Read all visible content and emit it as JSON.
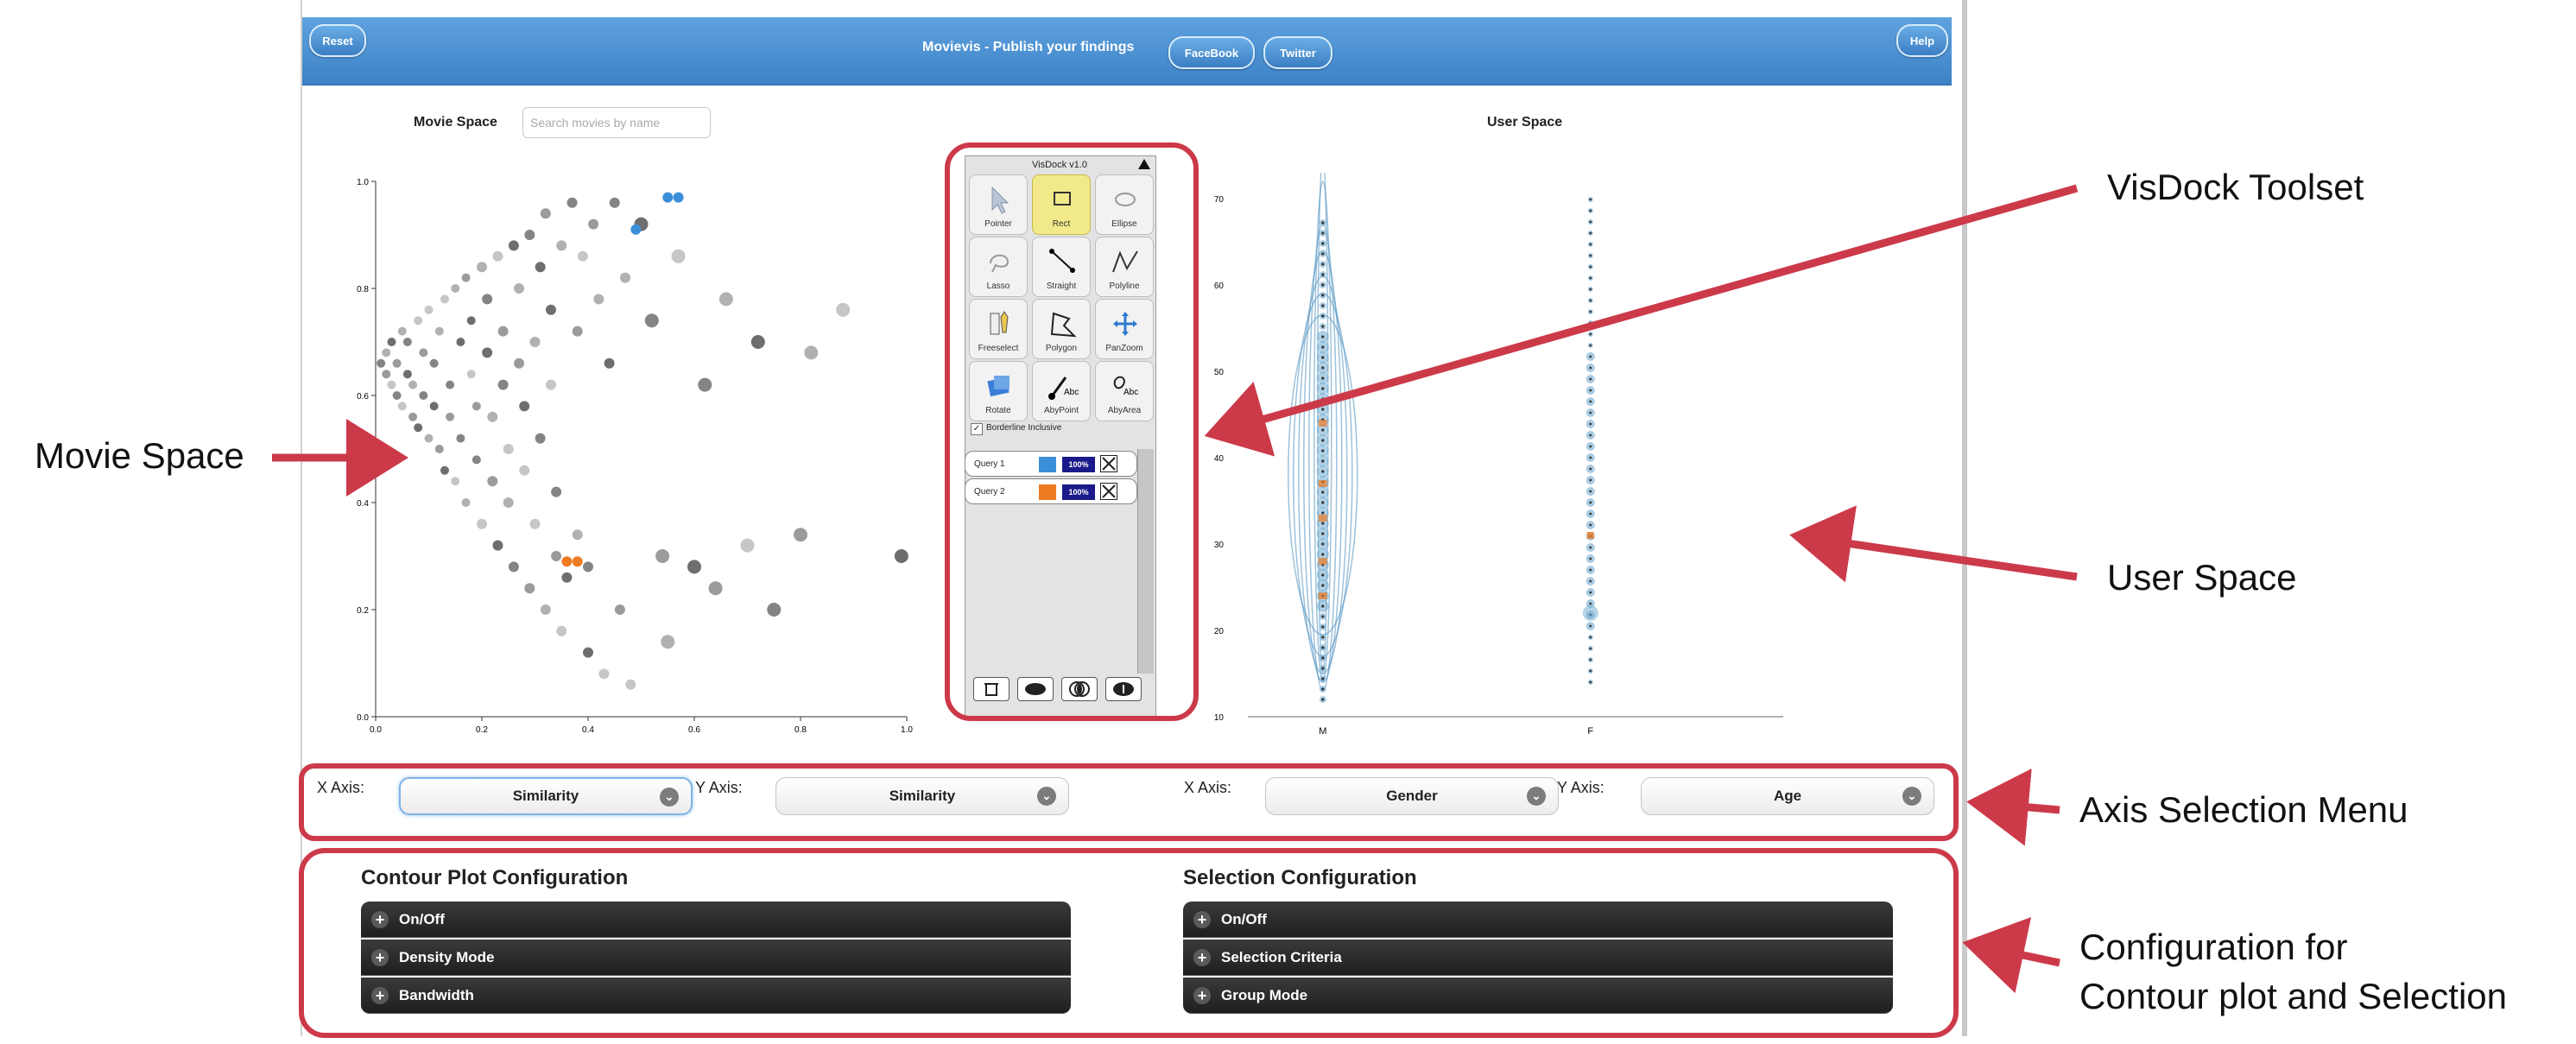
{
  "topbar": {
    "title": "Movievis - Publish your findings",
    "reset": "Reset",
    "facebook": "FaceBook",
    "twitter": "Twitter",
    "help": "Help"
  },
  "movie_space": {
    "label": "Movie Space",
    "search_placeholder": "Search movies by name",
    "chart_data": {
      "type": "scatter",
      "xlim": [
        0.0,
        1.0
      ],
      "ylim": [
        0.0,
        1.0
      ],
      "x_ticks": [
        "0.0",
        "0.2",
        "0.4",
        "0.6",
        "0.8",
        "1.0"
      ],
      "y_ticks": [
        "0.0",
        "0.2",
        "0.4",
        "0.6",
        "0.8",
        "1.0"
      ],
      "points": [
        [
          0.01,
          0.66
        ],
        [
          0.02,
          0.64
        ],
        [
          0.02,
          0.68
        ],
        [
          0.03,
          0.62
        ],
        [
          0.03,
          0.7
        ],
        [
          0.04,
          0.6
        ],
        [
          0.04,
          0.66
        ],
        [
          0.05,
          0.72
        ],
        [
          0.05,
          0.58
        ],
        [
          0.06,
          0.64
        ],
        [
          0.06,
          0.7
        ],
        [
          0.07,
          0.56
        ],
        [
          0.07,
          0.62
        ],
        [
          0.08,
          0.74
        ],
        [
          0.08,
          0.54
        ],
        [
          0.09,
          0.6
        ],
        [
          0.09,
          0.68
        ],
        [
          0.1,
          0.52
        ],
        [
          0.1,
          0.76
        ],
        [
          0.11,
          0.58
        ],
        [
          0.11,
          0.66
        ],
        [
          0.12,
          0.5
        ],
        [
          0.12,
          0.72
        ],
        [
          0.13,
          0.78
        ],
        [
          0.13,
          0.46
        ],
        [
          0.14,
          0.62
        ],
        [
          0.14,
          0.56
        ],
        [
          0.15,
          0.8
        ],
        [
          0.15,
          0.44
        ],
        [
          0.16,
          0.7
        ],
        [
          0.16,
          0.52
        ],
        [
          0.17,
          0.82
        ],
        [
          0.17,
          0.4
        ],
        [
          0.18,
          0.64
        ],
        [
          0.18,
          0.74
        ],
        [
          0.19,
          0.48
        ],
        [
          0.19,
          0.58
        ],
        [
          0.2,
          0.84
        ],
        [
          0.2,
          0.36
        ],
        [
          0.21,
          0.68
        ],
        [
          0.21,
          0.78
        ],
        [
          0.22,
          0.44
        ],
        [
          0.22,
          0.56
        ],
        [
          0.23,
          0.86
        ],
        [
          0.23,
          0.32
        ],
        [
          0.24,
          0.62
        ],
        [
          0.24,
          0.72
        ],
        [
          0.25,
          0.4
        ],
        [
          0.25,
          0.5
        ],
        [
          0.26,
          0.88
        ],
        [
          0.26,
          0.28
        ],
        [
          0.27,
          0.66
        ],
        [
          0.27,
          0.8
        ],
        [
          0.28,
          0.46
        ],
        [
          0.28,
          0.58
        ],
        [
          0.29,
          0.9
        ],
        [
          0.29,
          0.24
        ],
        [
          0.3,
          0.7
        ],
        [
          0.3,
          0.36
        ],
        [
          0.31,
          0.84
        ],
        [
          0.31,
          0.52
        ],
        [
          0.32,
          0.94
        ],
        [
          0.32,
          0.2
        ],
        [
          0.33,
          0.62
        ],
        [
          0.33,
          0.76
        ],
        [
          0.34,
          0.42
        ],
        [
          0.34,
          0.3
        ],
        [
          0.35,
          0.88
        ],
        [
          0.35,
          0.16
        ],
        [
          0.36,
          0.26
        ],
        [
          0.37,
          0.96
        ],
        [
          0.38,
          0.72
        ],
        [
          0.38,
          0.34
        ],
        [
          0.39,
          0.86
        ],
        [
          0.4,
          0.12
        ],
        [
          0.4,
          0.28
        ],
        [
          0.41,
          0.92
        ],
        [
          0.42,
          0.78
        ],
        [
          0.43,
          0.08
        ],
        [
          0.44,
          0.66
        ],
        [
          0.45,
          0.96
        ],
        [
          0.46,
          0.2
        ],
        [
          0.47,
          0.82
        ],
        [
          0.48,
          0.06
        ],
        [
          0.5,
          0.92
        ],
        [
          0.52,
          0.74
        ],
        [
          0.54,
          0.3
        ],
        [
          0.55,
          0.14
        ],
        [
          0.57,
          0.86
        ],
        [
          0.6,
          0.28
        ],
        [
          0.62,
          0.62
        ],
        [
          0.64,
          0.24
        ],
        [
          0.66,
          0.78
        ],
        [
          0.7,
          0.32
        ],
        [
          0.72,
          0.7
        ],
        [
          0.75,
          0.2
        ],
        [
          0.8,
          0.34
        ],
        [
          0.82,
          0.68
        ],
        [
          0.88,
          0.76
        ],
        [
          0.99,
          0.3
        ]
      ],
      "highlighted": {
        "query_1": [
          [
            0.55,
            0.97
          ],
          [
            0.57,
            0.97
          ],
          [
            0.49,
            0.91
          ]
        ],
        "query_2": [
          [
            0.36,
            0.29
          ],
          [
            0.38,
            0.29
          ]
        ]
      }
    }
  },
  "user_space": {
    "label": "User Space",
    "chart_data": {
      "type": "scatter",
      "categories": [
        "M",
        "F"
      ],
      "ylim": [
        10,
        72
      ],
      "y_ticks": [
        "10",
        "20",
        "30",
        "40",
        "50",
        "60",
        "70"
      ],
      "contour": true
    }
  },
  "visdock": {
    "title": "VisDock v1.0",
    "tools": [
      {
        "label": "Pointer",
        "icon": "pointer-icon"
      },
      {
        "label": "Rect",
        "icon": "rect-icon"
      },
      {
        "label": "Ellipse",
        "icon": "ellipse-icon"
      },
      {
        "label": "Lasso",
        "icon": "lasso-icon"
      },
      {
        "label": "Straight",
        "icon": "straight-icon"
      },
      {
        "label": "Polyline",
        "icon": "polyline-icon"
      },
      {
        "label": "Freeselect",
        "icon": "freeselect-icon"
      },
      {
        "label": "Polygon",
        "icon": "polygon-icon"
      },
      {
        "label": "PanZoom",
        "icon": "panzoom-icon"
      },
      {
        "label": "Rotate",
        "icon": "rotate-icon"
      },
      {
        "label": "AbyPoint",
        "icon": "annotate-point-icon"
      },
      {
        "label": "AbyArea",
        "icon": "annotate-area-icon"
      }
    ],
    "active_tool": "Rect",
    "borderline": "Borderline Inclusive",
    "queries": [
      {
        "name": "Query 1",
        "color": "#3b8fd9",
        "opacity": "100%"
      },
      {
        "name": "Query 2",
        "color": "#ee7a22",
        "opacity": "100%"
      }
    ]
  },
  "axis_menu": {
    "movie_x_label": "X Axis:",
    "movie_x_value": "Similarity",
    "movie_y_label": "Y Axis:",
    "movie_y_value": "Similarity",
    "user_x_label": "X Axis:",
    "user_x_value": "Gender",
    "user_y_label": "Y Axis:",
    "user_y_value": "Age"
  },
  "contour_config": {
    "title": "Contour Plot Configuration",
    "items": [
      "On/Off",
      "Density Mode",
      "Bandwidth"
    ]
  },
  "selection_config": {
    "title": "Selection Configuration",
    "items": [
      "On/Off",
      "Selection Criteria",
      "Group Mode"
    ]
  },
  "annotations": {
    "visdock_toolset": "VisDock Toolset",
    "movie_space": "Movie Space",
    "user_space": "User Space",
    "axis_selection_menu": "Axis Selection Menu",
    "config_line1": "Configuration for",
    "config_line2": "Contour plot and Selection"
  },
  "colors": {
    "accent": "#cc3a4a",
    "topbar": "#4a8fd1",
    "query_1": "#3b8fd9",
    "query_2": "#ee7a22"
  }
}
